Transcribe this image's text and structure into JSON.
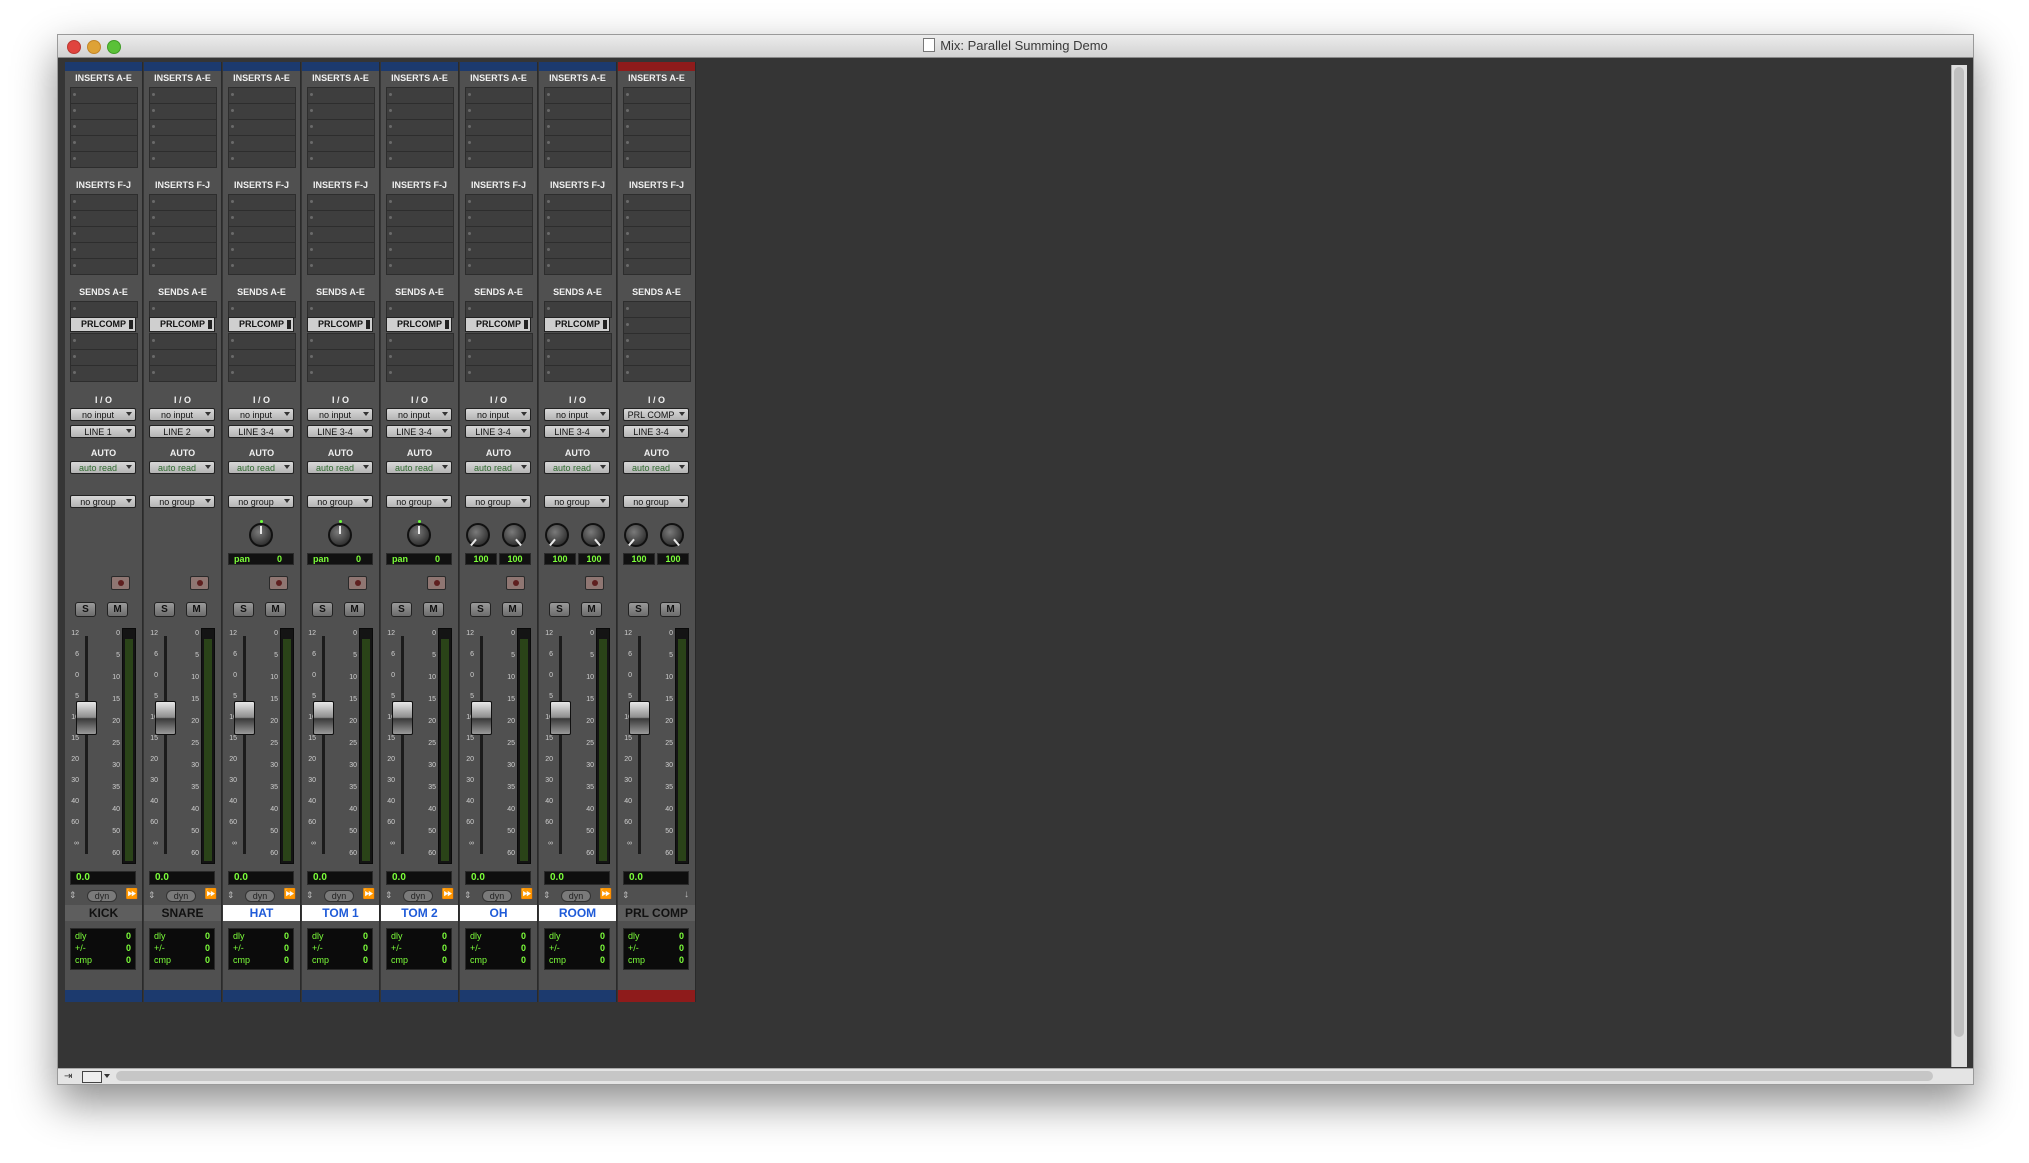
{
  "window": {
    "title": "Mix: Parallel Summing Demo"
  },
  "labels": {
    "inserts_ae": "INSERTS A-E",
    "inserts_fj": "INSERTS F-J",
    "sends_ae": "SENDS A-E",
    "io": "I / O",
    "auto": "AUTO",
    "solo": "S",
    "mute": "M",
    "dyn": "dyn",
    "dly": "dly",
    "plusminus": "+/-",
    "cmp": "cmp"
  },
  "colors": {
    "blue": "#1c3a6e",
    "red": "#8e1b1b",
    "meter": "#2a4318",
    "green_text": "#7cff3a"
  },
  "channels": [
    {
      "name": "KICK",
      "input": "no input",
      "output": "LINE 1",
      "auto": "auto read",
      "group": "no group",
      "send": "PRLCOMP",
      "pan": null,
      "volume": "0.0",
      "dly": "0",
      "pm": "0",
      "cmp": "0",
      "color": "#1c3a6e",
      "name_style": "gray",
      "rec": true,
      "fader": 0.43
    },
    {
      "name": "SNARE",
      "input": "no input",
      "output": "LINE 2",
      "auto": "auto read",
      "group": "no group",
      "send": "PRLCOMP",
      "pan": null,
      "volume": "0.0",
      "dly": "0",
      "pm": "0",
      "cmp": "0",
      "color": "#1c3a6e",
      "name_style": "gray",
      "rec": true,
      "fader": 0.43
    },
    {
      "name": "HAT",
      "input": "no input",
      "output": "LINE 3-4",
      "auto": "auto read",
      "group": "no group",
      "send": "PRLCOMP",
      "pan": {
        "type": "mono",
        "label": "pan",
        "value": "0"
      },
      "volume": "0.0",
      "dly": "0",
      "pm": "0",
      "cmp": "0",
      "color": "#1c3a6e",
      "name_style": "white",
      "rec": true,
      "fader": 0.43
    },
    {
      "name": "TOM 1",
      "input": "no input",
      "output": "LINE 3-4",
      "auto": "auto read",
      "group": "no group",
      "send": "PRLCOMP",
      "pan": {
        "type": "mono",
        "label": "pan",
        "value": "0"
      },
      "volume": "0.0",
      "dly": "0",
      "pm": "0",
      "cmp": "0",
      "color": "#1c3a6e",
      "name_style": "white",
      "rec": true,
      "fader": 0.43
    },
    {
      "name": "TOM 2",
      "input": "no input",
      "output": "LINE 3-4",
      "auto": "auto read",
      "group": "no group",
      "send": "PRLCOMP",
      "pan": {
        "type": "mono",
        "label": "pan",
        "value": "0"
      },
      "volume": "0.0",
      "dly": "0",
      "pm": "0",
      "cmp": "0",
      "color": "#1c3a6e",
      "name_style": "white",
      "rec": true,
      "fader": 0.43
    },
    {
      "name": "OH",
      "input": "no input",
      "output": "LINE 3-4",
      "auto": "auto read",
      "group": "no group",
      "send": "PRLCOMP",
      "pan": {
        "type": "stereo",
        "left": "100",
        "right": "100"
      },
      "volume": "0.0",
      "dly": "0",
      "pm": "0",
      "cmp": "0",
      "color": "#1c3a6e",
      "name_style": "white",
      "rec": true,
      "fader": 0.43
    },
    {
      "name": "ROOM",
      "input": "no input",
      "output": "LINE 3-4",
      "auto": "auto read",
      "group": "no group",
      "send": "PRLCOMP",
      "pan": {
        "type": "stereo",
        "left": "100",
        "right": "100"
      },
      "volume": "0.0",
      "dly": "0",
      "pm": "0",
      "cmp": "0",
      "color": "#1c3a6e",
      "name_style": "white",
      "rec": true,
      "fader": 0.43
    },
    {
      "name": "PRL COMP",
      "input": "PRL COMP",
      "output": "LINE 3-4",
      "auto": "auto read",
      "group": "no group",
      "send": null,
      "pan": {
        "type": "stereo",
        "left": "100",
        "right": "100"
      },
      "volume": "0.0",
      "dly": "0",
      "pm": "0",
      "cmp": "0",
      "color": "#8e1b1b",
      "name_style": "gray",
      "rec": false,
      "fader": 0.43
    }
  ],
  "fader_scale": [
    "12",
    "6",
    "0",
    "5",
    "10",
    "15",
    "20",
    "30",
    "40",
    "60",
    "∞"
  ],
  "meter_scale": [
    "0",
    "5",
    "10",
    "15",
    "20",
    "25",
    "30",
    "35",
    "40",
    "50",
    "60"
  ]
}
